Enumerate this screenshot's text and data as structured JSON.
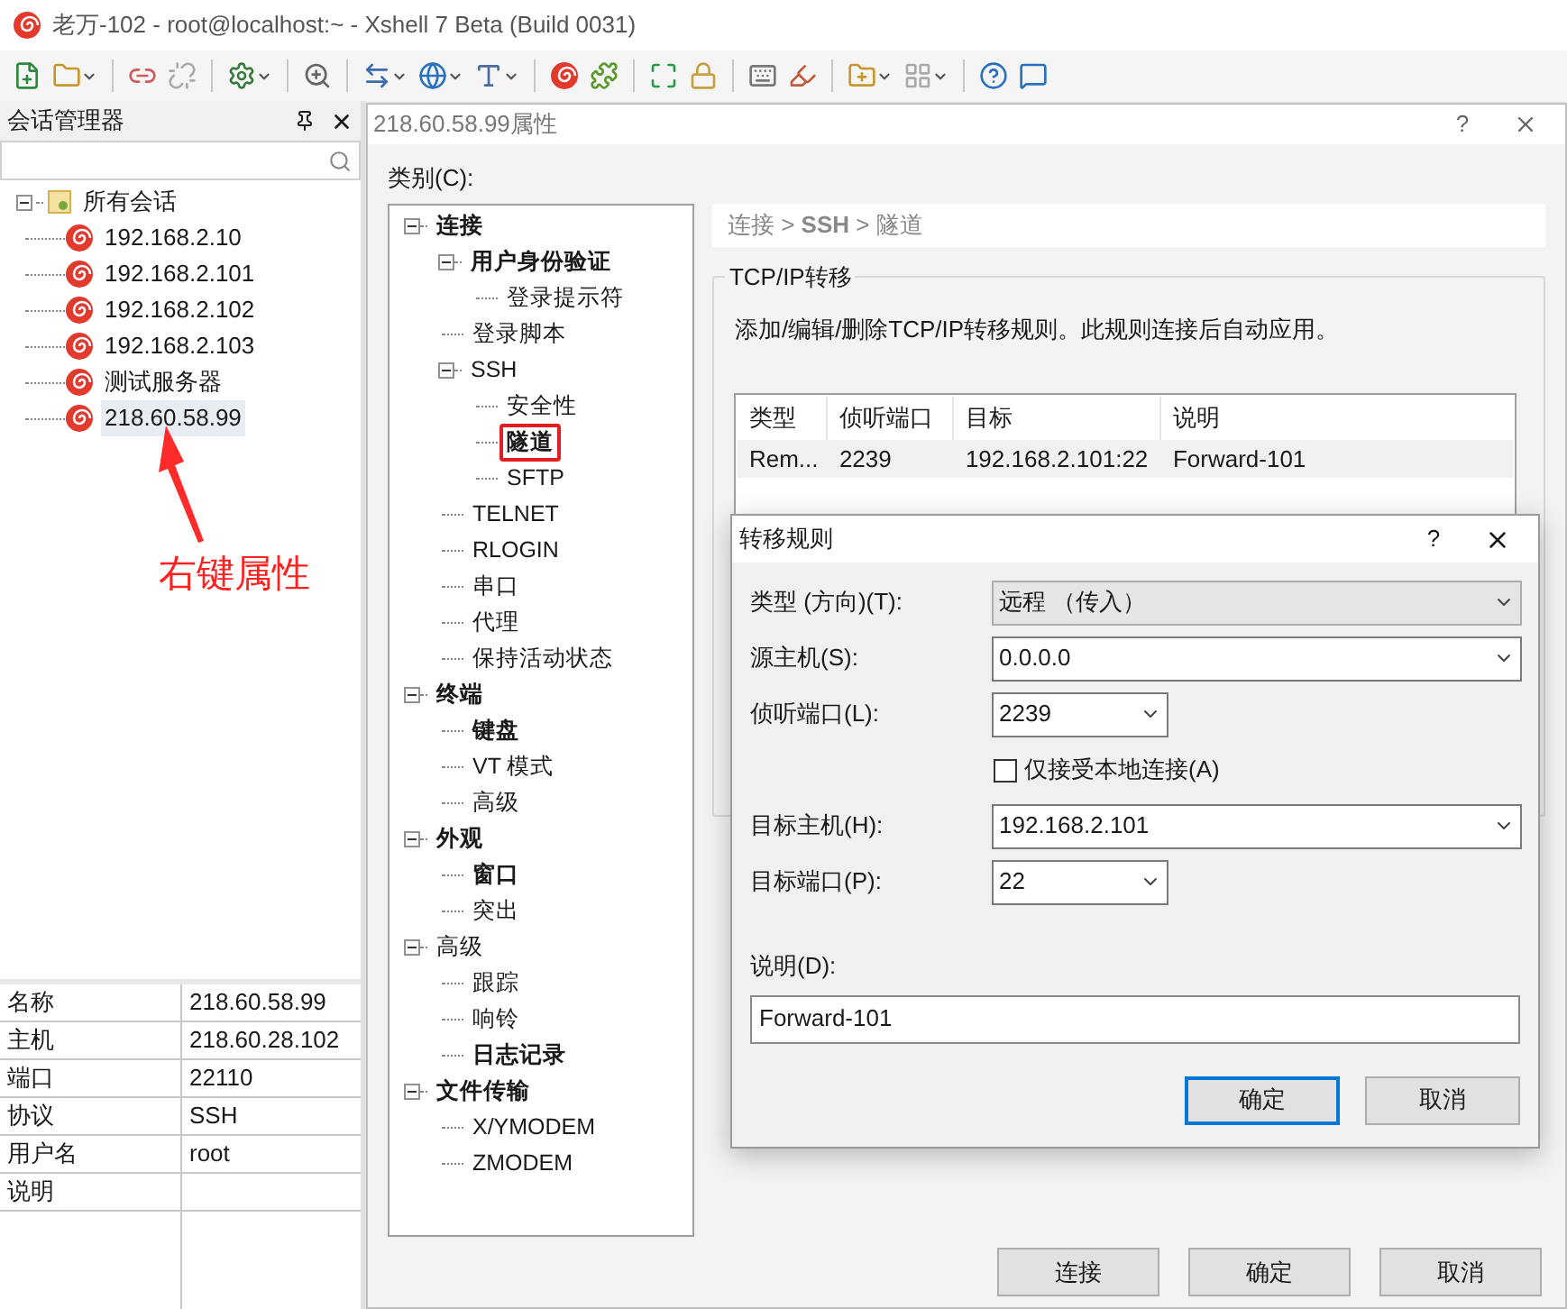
{
  "window": {
    "title": "老万-102 - root@localhost:~ - Xshell 7 Beta (Build 0031)"
  },
  "session_manager": {
    "title": "会话管理器",
    "tree": {
      "label": "所有会话",
      "expanded": true,
      "children": [
        {
          "label": "192.168.2.10",
          "selected": false
        },
        {
          "label": "192.168.2.101",
          "selected": false
        },
        {
          "label": "192.168.2.102",
          "selected": false
        },
        {
          "label": "192.168.2.103",
          "selected": false
        },
        {
          "label": "测试服务器",
          "selected": false
        },
        {
          "label": "218.60.58.99",
          "selected": true
        }
      ]
    }
  },
  "annotation": {
    "text": "右键属性"
  },
  "properties": [
    {
      "name": "名称",
      "value": "218.60.58.99"
    },
    {
      "name": "主机",
      "value": "218.60.28.102"
    },
    {
      "name": "端口",
      "value": "22110"
    },
    {
      "name": "协议",
      "value": "SSH"
    },
    {
      "name": "用户名",
      "value": "root"
    },
    {
      "name": "说明"
    }
  ],
  "properties_dialog": {
    "title": "218.60.58.99属性",
    "help": "?",
    "category_label": "类别(C):",
    "categories": [
      {
        "label": "连接",
        "bold": true,
        "outlined": false,
        "expanded": true,
        "children": [
          {
            "label": "用户身份验证",
            "bold": true,
            "outlined": false,
            "expanded": true,
            "children": [
              {
                "label": "登录提示符",
                "bold": false,
                "outlined": false
              }
            ]
          },
          {
            "label": "登录脚本",
            "bold": false,
            "outlined": false
          },
          {
            "label": "SSH",
            "bold": false,
            "outlined": false,
            "expanded": true,
            "children": [
              {
                "label": "安全性",
                "bold": false,
                "outlined": false
              },
              {
                "label": "隧道",
                "bold": true,
                "outlined": true
              },
              {
                "label": "SFTP",
                "bold": false,
                "outlined": false
              }
            ]
          },
          {
            "label": "TELNET",
            "bold": false,
            "outlined": false
          },
          {
            "label": "RLOGIN",
            "bold": false,
            "outlined": false
          },
          {
            "label": "串口",
            "bold": false,
            "outlined": false
          },
          {
            "label": "代理",
            "bold": false,
            "outlined": false
          },
          {
            "label": "保持活动状态",
            "bold": false,
            "outlined": false
          }
        ]
      },
      {
        "label": "终端",
        "bold": true,
        "outlined": false,
        "expanded": true,
        "children": [
          {
            "label": "键盘",
            "bold": true,
            "outlined": false
          },
          {
            "label": "VT 模式",
            "bold": false,
            "outlined": false
          },
          {
            "label": "高级",
            "bold": false,
            "outlined": false
          }
        ]
      },
      {
        "label": "外观",
        "bold": true,
        "outlined": false,
        "expanded": true,
        "children": [
          {
            "label": "窗口",
            "bold": true,
            "outlined": false
          },
          {
            "label": "突出",
            "bold": false,
            "outlined": false
          }
        ]
      },
      {
        "label": "高级",
        "bold": false,
        "outlined": false,
        "expanded": true,
        "children": [
          {
            "label": "跟踪",
            "bold": false,
            "outlined": false
          },
          {
            "label": "响铃",
            "bold": false,
            "outlined": false
          },
          {
            "label": "日志记录",
            "bold": true,
            "outlined": false
          }
        ]
      },
      {
        "label": "文件传输",
        "bold": true,
        "outlined": false,
        "expanded": true,
        "children": [
          {
            "label": "X/YMODEM",
            "bold": false,
            "outlined": false
          },
          {
            "label": "ZMODEM",
            "bold": false,
            "outlined": false
          }
        ]
      }
    ],
    "breadcrumb": "连接 > **SSH** > 隧道",
    "group_title": "TCP/IP转移",
    "description": "添加/编辑/删除TCP/IP转移规则。此规则连接后自动应用。",
    "table": {
      "columns": [
        "类型",
        "侦听端口",
        "目标",
        "说明"
      ],
      "rows": [
        {
          "cells": [
            "Rem...",
            "2239",
            "192.168.2.101:22",
            "Forward-101"
          ],
          "selected": true
        }
      ]
    },
    "buttons": [
      "连接",
      "确定",
      "取消"
    ]
  },
  "rule_dialog": {
    "title": "转移规则",
    "help": "?",
    "fields": [
      {
        "kind": "dropdown",
        "label": "类型 (方向)(T):",
        "value": "远程 （传入）"
      },
      {
        "kind": "combo",
        "label": "源主机(S):",
        "value": "0.0.0.0"
      },
      {
        "kind": "shortcombo",
        "label": "侦听端口(L):",
        "value": "2239"
      },
      {
        "kind": "checkbox",
        "label": "仅接受本地连接(A)",
        "checked": false
      },
      {
        "kind": "combo",
        "label": "目标主机(H):",
        "value": "192.168.2.101"
      },
      {
        "kind": "shortcombo",
        "label": "目标端口(P):",
        "value": "22"
      },
      {
        "kind": "text",
        "label": "说明(D):",
        "value": "Forward-101"
      }
    ],
    "buttons": [
      {
        "label": "确定",
        "default": true
      },
      {
        "label": "取消",
        "default": false
      }
    ]
  }
}
